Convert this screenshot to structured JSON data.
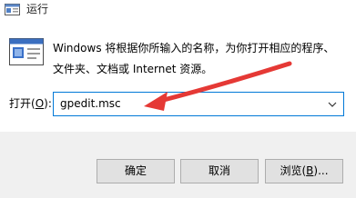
{
  "window": {
    "title": "运行"
  },
  "description": {
    "line1": "Windows 将根据你所输入的名称，为你打开相应的程序、",
    "line2": "文件夹、文档或 Internet 资源。"
  },
  "open_field": {
    "label_prefix": "打开(",
    "label_key": "O",
    "label_suffix": "):",
    "value": "gpedit.msc"
  },
  "buttons": {
    "ok": "确定",
    "cancel": "取消",
    "browse_prefix": "浏览(",
    "browse_key": "B",
    "browse_suffix": ")..."
  },
  "colors": {
    "accent": "#0078d7",
    "annotation_arrow": "#e53935",
    "footer_bg": "#f0f0f0"
  },
  "icons": {
    "title": "run-icon",
    "content": "run-icon-large",
    "dropdown": "chevron-down-icon",
    "annotation": "red-arrow-annotation"
  }
}
